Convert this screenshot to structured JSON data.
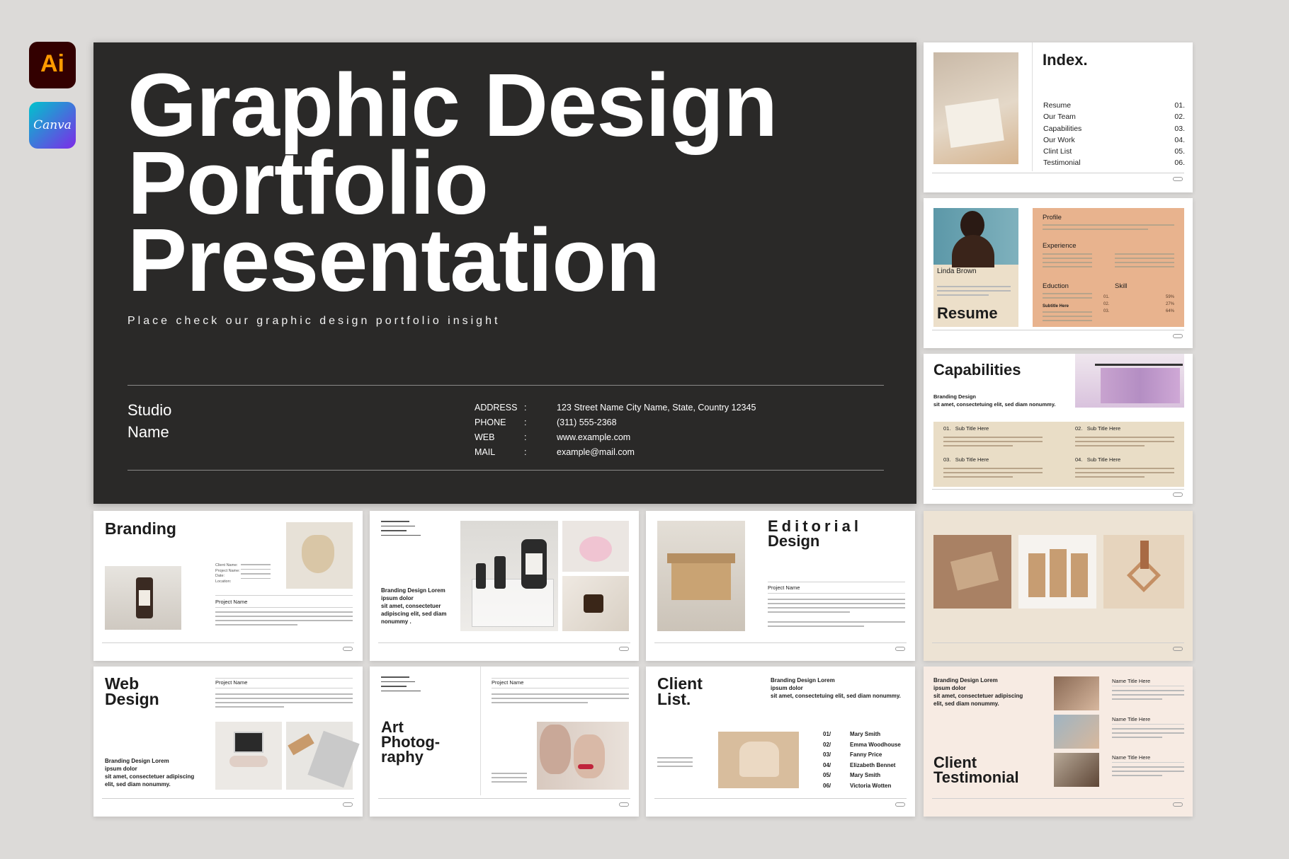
{
  "app_icons": [
    {
      "name": "illustrator-icon",
      "label": "Ai",
      "color": "#330000",
      "accent": "#ff9a00"
    },
    {
      "name": "canva-icon",
      "label": "Canva",
      "color": "#7d2ae8",
      "accent": "#00c4cc"
    }
  ],
  "cover": {
    "title_line1": "Graphic Design",
    "title_line2": "Portfolio",
    "title_line3": "Presentation",
    "subtitle": "Place check our graphic design portfolio insight",
    "studio_name": "Studio Name",
    "contact": [
      {
        "key": "ADDRESS",
        "sep": ":",
        "value": "123 Street Name City Name, State, Country 12345"
      },
      {
        "key": "PHONE",
        "sep": ":",
        "value": "(311) 555-2368"
      },
      {
        "key": "WEB",
        "sep": ":",
        "value": "www.example.com"
      },
      {
        "key": "MAIL",
        "sep": ":",
        "value": "example@mail.com"
      }
    ]
  },
  "index_slide": {
    "title": "Index.",
    "items": [
      {
        "label": "Resume",
        "num": "01."
      },
      {
        "label": "Our Team",
        "num": "02."
      },
      {
        "label": "Capabilities",
        "num": "03."
      },
      {
        "label": "Our Work",
        "num": "04."
      },
      {
        "label": "Clint List",
        "num": "05."
      },
      {
        "label": "Testimonial",
        "num": "06."
      }
    ]
  },
  "resume_slide": {
    "person_name": "Linda Brown",
    "title": "Resume",
    "profile": "Profile",
    "experience": "Experience",
    "education": "Eduction",
    "skill": "Skill",
    "subtitle_here": "Subtitle Here",
    "skill_nums": [
      "01.",
      "02.",
      "03."
    ],
    "skill_pcts": [
      "59%",
      "27%",
      "64%"
    ]
  },
  "capabilities_slide": {
    "title": "Capabilities",
    "bold_line1": "Branding Design",
    "bold_line2": "sit amet, consectetuing elit, sed diam nonummy.",
    "items": [
      {
        "num": "01.",
        "label": "Sub Title Here"
      },
      {
        "num": "02.",
        "label": "Sub Title Here"
      },
      {
        "num": "03.",
        "label": "Sub Title Here"
      },
      {
        "num": "04.",
        "label": "Sub Title Here"
      }
    ]
  },
  "branding_slide": {
    "title": "Branding",
    "project_name": "Project Name",
    "details": [
      "Client Name:",
      "Project Name:",
      "Date:",
      "Location:"
    ]
  },
  "product_slide": {
    "bold_line1": "Branding Design Lorem",
    "bold_line2": "ipsum dolor",
    "bold_line3": "sit amet, consectetuer",
    "bold_line4": "adipiscing elit, sed diam",
    "bold_line5": "nonummy ."
  },
  "editorial_slide": {
    "title_line1": "Editorial",
    "title_line2": "Design",
    "project_name": "Project Name"
  },
  "web_slide": {
    "title_line1": "Web",
    "title_line2": "Design",
    "project_name": "Project Name",
    "bold_line1": "Branding Design Lorem",
    "bold_line2": "ipsum dolor",
    "bold_line3": "sit amet, consectetuer adipiscing",
    "bold_line4": "elit, sed diam nonummy."
  },
  "art_slide": {
    "title_line1": "Art",
    "title_line2": "Photog-",
    "title_line3": "raphy",
    "project_name": "Project Name"
  },
  "client_list_slide": {
    "title_line1": "Client",
    "title_line2": "List.",
    "bold_line1": "Branding Design Lorem",
    "bold_line2": "ipsum dolor",
    "bold_line3": "sit amet, consectetuing elit, sed diam nonummy.",
    "clients": [
      {
        "num": "01/",
        "name": "Mary Smith"
      },
      {
        "num": "02/",
        "name": "Emma Woodhouse"
      },
      {
        "num": "03/",
        "name": "Fanny Price"
      },
      {
        "num": "04/",
        "name": "Elizabeth Bennet"
      },
      {
        "num": "05/",
        "name": "Mary Smith"
      },
      {
        "num": "06/",
        "name": "Victoria Wotten"
      }
    ]
  },
  "testimonial_slide": {
    "bold_line1": "Branding Design Lorem",
    "bold_line2": "ipsum dolor",
    "bold_line3": "sit amet, consectetuer adipiscing",
    "bold_line4": "elit, sed diam nonummy.",
    "title_line1": "Client",
    "title_line2": "Testimonial",
    "names": [
      "Name Title Here",
      "Name Title Here",
      "Name Title Here"
    ]
  }
}
